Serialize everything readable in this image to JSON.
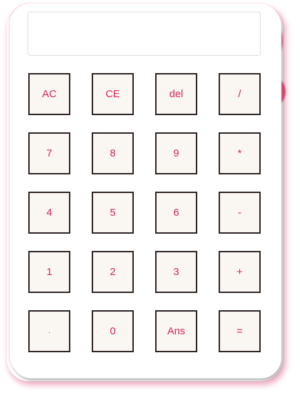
{
  "calculator": {
    "display_value": "",
    "accent_color": "#d6245a",
    "key_border_color": "#2a2020",
    "key_background": "#faf6f2",
    "keys": [
      {
        "label": "AC"
      },
      {
        "label": "CE"
      },
      {
        "label": "del"
      },
      {
        "label": "/"
      },
      {
        "label": "7"
      },
      {
        "label": "8"
      },
      {
        "label": "9"
      },
      {
        "label": "*"
      },
      {
        "label": "4"
      },
      {
        "label": "5"
      },
      {
        "label": "6"
      },
      {
        "label": "-"
      },
      {
        "label": "1"
      },
      {
        "label": "2"
      },
      {
        "label": "3"
      },
      {
        "label": "+"
      },
      {
        "label": "."
      },
      {
        "label": "0"
      },
      {
        "label": "Ans"
      },
      {
        "label": "="
      }
    ]
  }
}
